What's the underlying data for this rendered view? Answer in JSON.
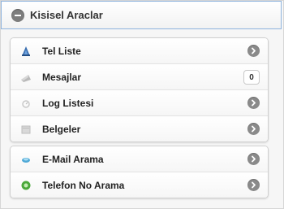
{
  "header": {
    "title": "Kisisel Araclar",
    "icon": "minus-circle-icon"
  },
  "groups": [
    {
      "items": [
        {
          "label": "Tel Liste",
          "icon": "phonebook-icon",
          "indicator": "arrow"
        },
        {
          "label": "Mesajlar",
          "icon": "message-icon",
          "indicator": "count",
          "count": "0"
        },
        {
          "label": "Log Listesi",
          "icon": "log-icon",
          "indicator": "arrow"
        },
        {
          "label": "Belgeler",
          "icon": "document-icon",
          "indicator": "arrow"
        }
      ]
    },
    {
      "items": [
        {
          "label": "E-Mail Arama",
          "icon": "email-search-icon",
          "indicator": "arrow"
        },
        {
          "label": "Telefon No Arama",
          "icon": "phone-search-icon",
          "indicator": "arrow"
        }
      ]
    }
  ],
  "colors": {
    "header_border": "#8fb4de",
    "arrow_bg": "#8a8a8a",
    "background": "#f1f1f1"
  }
}
